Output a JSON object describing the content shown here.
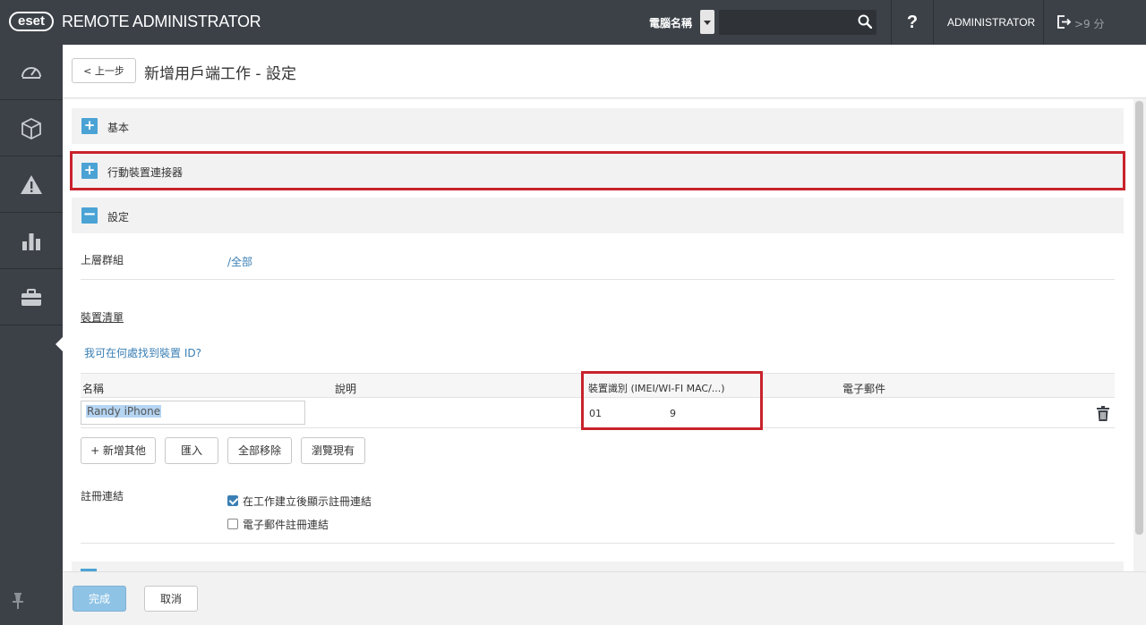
{
  "topbar": {
    "logo": "eset",
    "app_title": "REMOTE ADMINISTRATOR",
    "search_scope": "電腦名稱",
    "search_placeholder": "",
    "help": "?",
    "user": "ADMINISTRATOR",
    "session": ">9 分"
  },
  "sidebar": {
    "items": [
      {
        "icon": "dashboard-icon"
      },
      {
        "icon": "computers-icon"
      },
      {
        "icon": "threats-icon"
      },
      {
        "icon": "reports-icon"
      },
      {
        "icon": "admin-icon",
        "active": true
      }
    ]
  },
  "header": {
    "back_label": "< 上一步",
    "title": "新增用戶端工作 - 設定"
  },
  "sections": {
    "basic": {
      "toggle": "+",
      "title": "基本"
    },
    "mobile_connector": {
      "toggle": "+",
      "title": "行動裝置連接器"
    },
    "settings": {
      "toggle": "−",
      "title": "設定"
    }
  },
  "settings": {
    "parent_group_label": "上層群組",
    "parent_group_value": "/全部",
    "device_list_label": "裝置清單",
    "device_id_help": "我可在何處找到裝置 ID?",
    "columns": {
      "name": "名稱",
      "description": "說明",
      "device_id": "裝置識別 (IMEI/WI-FI MAC/...)",
      "email": "電子郵件"
    },
    "rows": [
      {
        "name": "Randy iPhone",
        "description": "",
        "device_id_a": "01",
        "device_id_b": "9",
        "email": ""
      }
    ],
    "buttons": {
      "add_more": "+ 新增其他",
      "import": "匯入",
      "remove_all": "全部移除",
      "browse": "瀏覽現有"
    },
    "enroll_link_label": "註冊連結",
    "options": {
      "show_link": {
        "label": "在工作建立後顯示註冊連結",
        "checked": true
      },
      "email_link": {
        "label": "電子郵件註冊連結",
        "checked": false
      }
    }
  },
  "footer": {
    "done": "完成",
    "cancel": "取消"
  },
  "colors": {
    "topbar": "#3c4148",
    "accent": "#4ba3d5",
    "link": "#3a7fb4",
    "highlight": "#c8232c"
  }
}
